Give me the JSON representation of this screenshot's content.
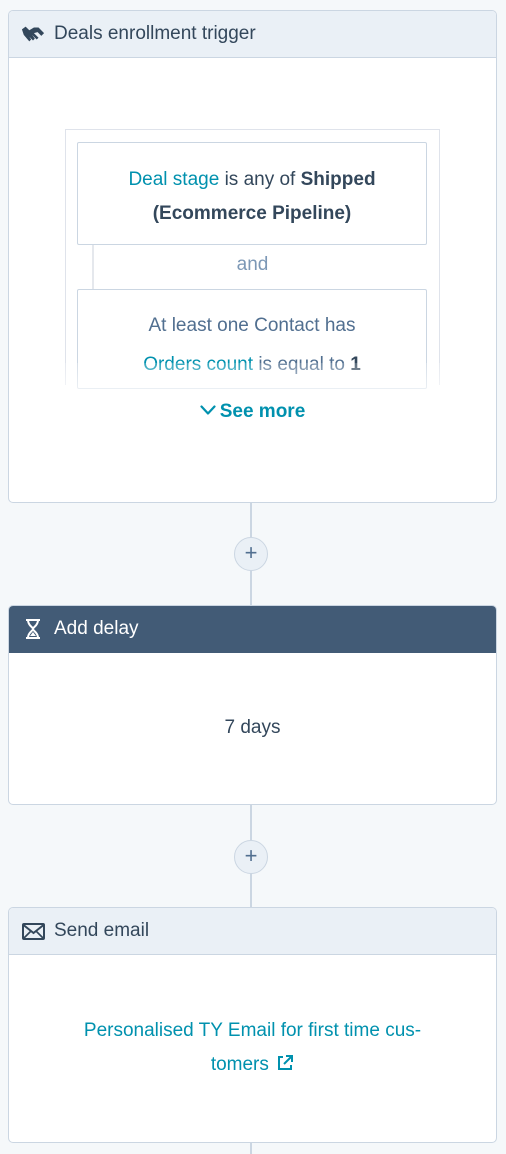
{
  "trigger": {
    "header": "Deals enrollment trigger",
    "icon": "handshake-icon",
    "filter1": {
      "property": "Deal stage",
      "operator": "is any of",
      "value_line1": "Shipped",
      "value_line2": "(Ecommerce Pipeline)"
    },
    "joiner": "and",
    "filter2": {
      "line1": "At least one Contact has",
      "property": "Orders count",
      "operator": "is equal to",
      "value": "1"
    },
    "see_more": "See more"
  },
  "plus_label": "+",
  "delay": {
    "header": "Add delay",
    "icon": "hourglass-icon",
    "value": "7 days"
  },
  "email": {
    "header": "Send email",
    "icon": "envelope-icon",
    "link_line1": "Personalised TY Email for first time cus-",
    "link_line2": "tomers",
    "external_icon": "external-link-icon"
  },
  "colors": {
    "link": "#0091ae",
    "header_dark": "#425b76",
    "header_light": "#eaf0f6",
    "border": "#cbd6e2"
  }
}
